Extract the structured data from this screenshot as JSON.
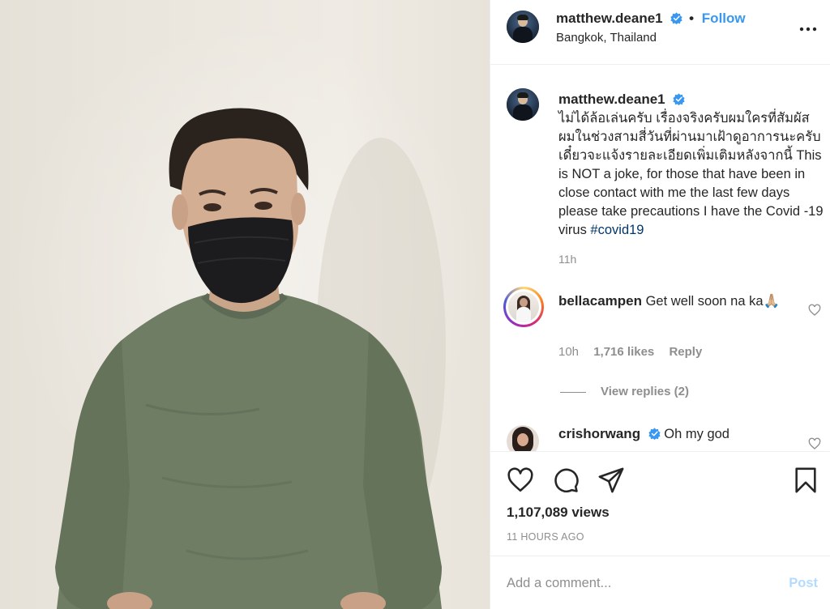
{
  "post": {
    "username": "matthew.deane1",
    "follow_label": "Follow",
    "location": "Bangkok, Thailand",
    "caption_text": "ไม่ได้ล้อเล่นครับ เรื่องจริงครับผมใครที่สัมผัสผมในช่วงสามสี่วันที่ผ่านมาเฝ้าดูอาการนะครับ เดี๋ยวจะแจ้งรายละเอียดเพิ่มเติมหลังจากนี้ This is NOT a joke, for those that have been in close contact with me the last few days please take precautions I have the Covid -19 virus ",
    "hashtag": "#covid19",
    "caption_time": "11h",
    "views": "1,107,089 views",
    "posted_ago": "11 HOURS AGO"
  },
  "comments": [
    {
      "username": "bellacampen",
      "text": "Get well soon na ka🙏🏼",
      "time": "10h",
      "likes": "1,716 likes",
      "reply_label": "Reply",
      "view_replies": "View replies (2)"
    },
    {
      "username": "crishorwang",
      "text": "Oh my god"
    }
  ],
  "composer": {
    "placeholder": "Add a comment...",
    "post_label": "Post"
  },
  "icons": {
    "more": "more-options-icon",
    "like": "heart-icon",
    "comment": "comment-icon",
    "share": "share-icon",
    "save": "bookmark-icon",
    "verified": "verified-badge-icon"
  },
  "colors": {
    "link_blue": "#3897f0",
    "hashtag": "#00376b",
    "muted": "#8e8e8e",
    "post_disabled": "#b3dbff"
  }
}
